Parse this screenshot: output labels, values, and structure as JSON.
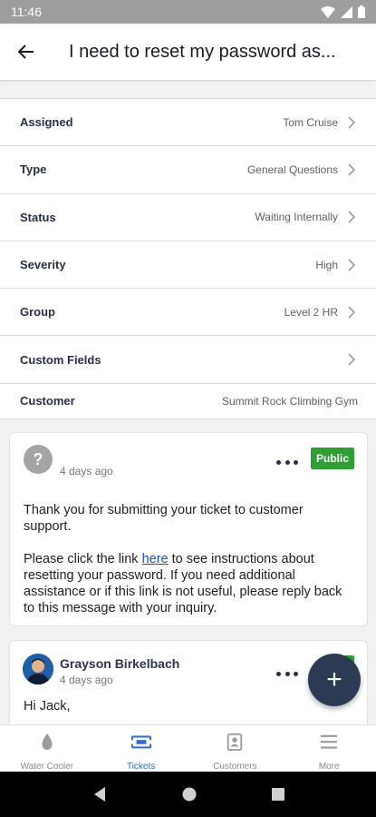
{
  "statusbar": {
    "time": "11:46"
  },
  "header": {
    "title": "I need to reset my password as..."
  },
  "fields": [
    {
      "label": "Assigned",
      "value": "Tom Cruise"
    },
    {
      "label": "Type",
      "value": "General Questions"
    },
    {
      "label": "Status",
      "value": "Waiting Internally"
    },
    {
      "label": "Severity",
      "value": "High"
    },
    {
      "label": "Group",
      "value": "Level 2 HR"
    },
    {
      "label": "Custom Fields",
      "value": ""
    },
    {
      "label": "Customer",
      "value": "Summit Rock Climbing Gym"
    }
  ],
  "messages": [
    {
      "author": "",
      "avatar_letter": "?",
      "time": "4 days ago",
      "badge": "Public",
      "paragraph1": "Thank you for submitting your ticket to customer support.",
      "paragraph2_before": "Please click the link ",
      "paragraph2_link": "here",
      "paragraph2_after": " to see instructions about resetting your password. If you need additional assistance or if this link is not useful, please reply back to this message with your inquiry."
    },
    {
      "author": "Grayson Birkelbach",
      "time": "4 days ago",
      "greeting": "Hi Jack,"
    }
  ],
  "fab": {
    "label": "+"
  },
  "bottom_nav": [
    {
      "label": "Water Cooler",
      "icon": "water-drop-icon"
    },
    {
      "label": "Tickets",
      "icon": "ticket-icon",
      "active": true
    },
    {
      "label": "Customers",
      "icon": "contact-card-icon"
    },
    {
      "label": "More",
      "icon": "menu-icon"
    }
  ],
  "colors": {
    "accent": "#2b6fd6",
    "badge_public": "#2e9e35",
    "fab": "#2c3b53",
    "link": "#1a4fd1"
  }
}
